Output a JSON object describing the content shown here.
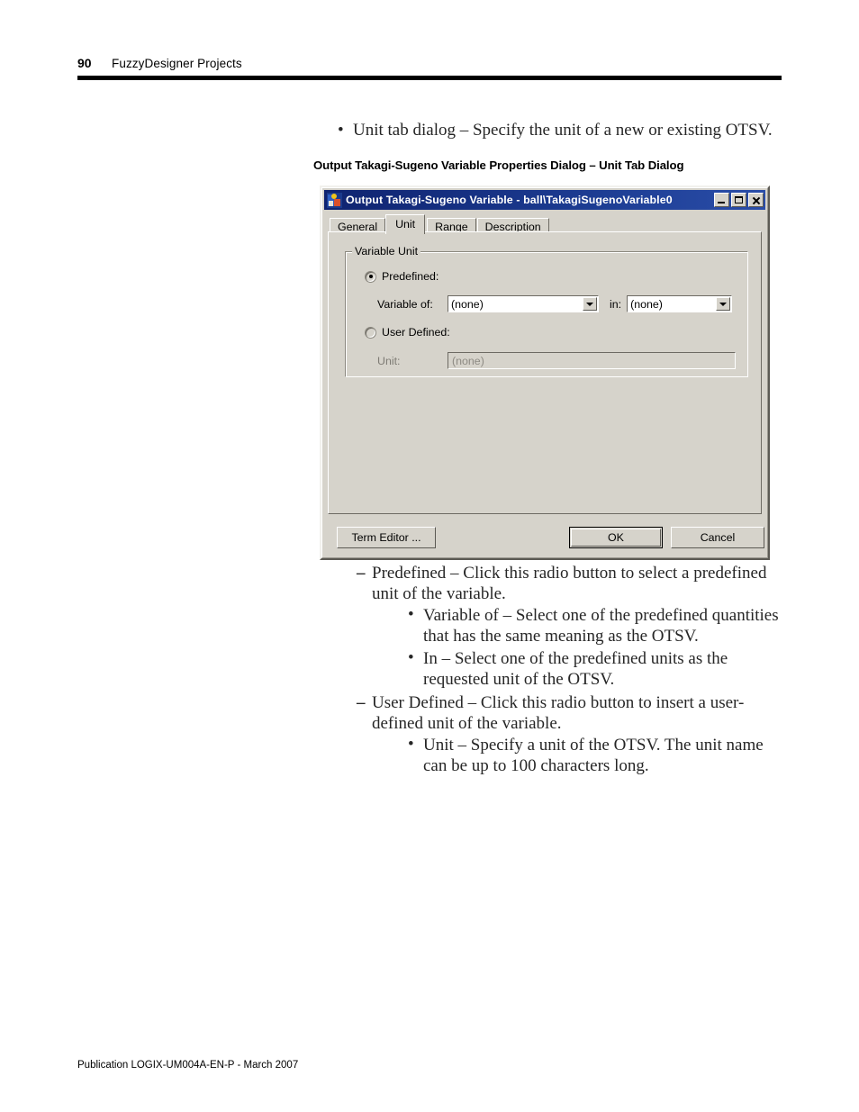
{
  "page": {
    "number": "90",
    "header_title": "FuzzyDesigner Projects",
    "footer": "Publication LOGIX-UM004A-EN-P - March 2007"
  },
  "intro": {
    "bullet_marker": "•",
    "text": "Unit tab dialog – Specify the unit of a new or existing OTSV."
  },
  "caption": "Output Takagi-Sugeno Variable Properties Dialog – Unit Tab Dialog",
  "dialog": {
    "title": "Output Takagi-Sugeno Variable - ball\\TakagiSugenoVariable0",
    "icon": "app-icon",
    "window_buttons": {
      "minimize": "minimize-icon",
      "maximize": "maximize-icon",
      "close": "close-icon"
    },
    "tabs": [
      {
        "label": "General",
        "active": false
      },
      {
        "label": "Unit",
        "active": true
      },
      {
        "label": "Range",
        "active": false
      },
      {
        "label": "Description",
        "active": false
      }
    ],
    "group": {
      "legend": "Variable Unit",
      "predefined": {
        "label": "Predefined:",
        "selected": true,
        "variable_of_label": "Variable of:",
        "variable_of_value": "(none)",
        "in_label": "in:",
        "in_value": "(none)"
      },
      "user_defined": {
        "label": "User Defined:",
        "selected": false,
        "unit_label": "Unit:",
        "unit_value": "(none)",
        "unit_enabled": false
      }
    },
    "buttons": {
      "term_editor": "Term Editor ...",
      "ok": "OK",
      "cancel": "Cancel"
    }
  },
  "notes": [
    {
      "marker": "–",
      "text": "Predefined – Click this radio button to select a predefined unit of the variable.",
      "sub": [
        {
          "marker": "•",
          "text": "Variable of – Select one of the predefined quantities that has the same meaning as the OTSV."
        },
        {
          "marker": "•",
          "text": "In – Select one of the predefined units as the requested unit of the OTSV."
        }
      ]
    },
    {
      "marker": "–",
      "text": "User Defined – Click this radio button to insert a user-defined unit of the variable.",
      "sub": [
        {
          "marker": "•",
          "text": "Unit – Specify a unit of the OTSV. The unit name can be up to 100 characters long."
        }
      ]
    }
  ]
}
